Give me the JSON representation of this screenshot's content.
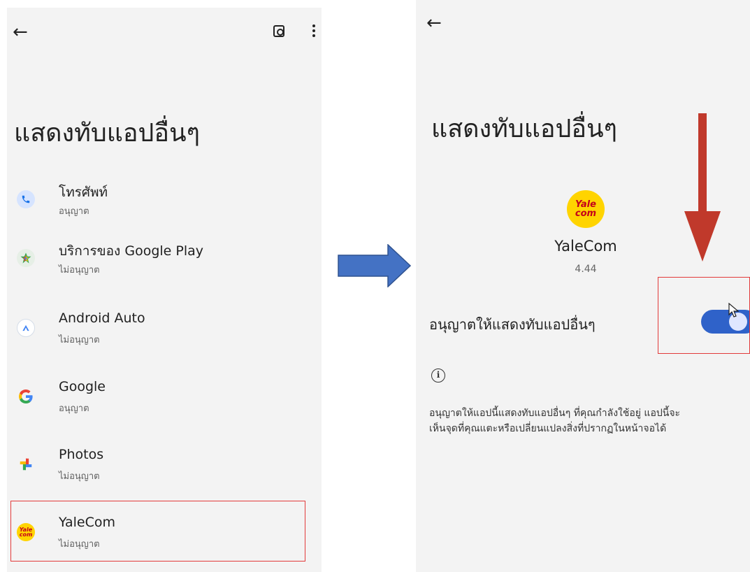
{
  "left_screen": {
    "title": "แสดงทับแอปอื่นๆ",
    "back_icon": "back-arrow-icon",
    "search_icon": "search-in-page-icon",
    "more_icon": "more-vert-icon",
    "apps": [
      {
        "name": "โทรศัพท์",
        "status": "อนุญาต",
        "icon": "phone-icon"
      },
      {
        "name": "บริการของ Google Play",
        "status": "ไม่อนุญาต",
        "icon": "google-play-services-icon"
      },
      {
        "name": "Android Auto",
        "status": "ไม่อนุญาต",
        "icon": "android-auto-icon"
      },
      {
        "name": "Google",
        "status": "อนุญาต",
        "icon": "google-icon"
      },
      {
        "name": "Photos",
        "status": "ไม่อนุญาต",
        "icon": "photos-icon"
      },
      {
        "name": "YaleCom",
        "status": "ไม่อนุญาต",
        "icon": "yalecom-icon"
      }
    ],
    "yale_icon_text": [
      "Yale",
      "com"
    ]
  },
  "right_screen": {
    "title": "แสดงทับแอปอื่นๆ",
    "back_icon": "back-arrow-icon",
    "app_name": "YaleCom",
    "version": "4.44",
    "toggle_label": "อนุญาตให้แสดงทับแอปอื่นๆ",
    "toggle_on": true,
    "info_icon": "info-icon",
    "description_line1": "อนุญาตให้แอปนี้แสดงทับแอปอื่นๆ ที่คุณกำลังใช้อยู่ แอปนี้จะ",
    "description_line2": "เห็นจุดที่คุณแตะหรือเปลี่ยนแปลงสิ่งที่ปรากฏในหน้าจอได้"
  },
  "colors": {
    "panel_bg": "#f3f3f3",
    "toggle_accent": "#2f62c9",
    "highlight_red": "#e23a3a",
    "flow_arrow_blue": "#4472c4",
    "pointer_arrow_red": "#c0392b",
    "yale_yellow": "#ffd400"
  }
}
